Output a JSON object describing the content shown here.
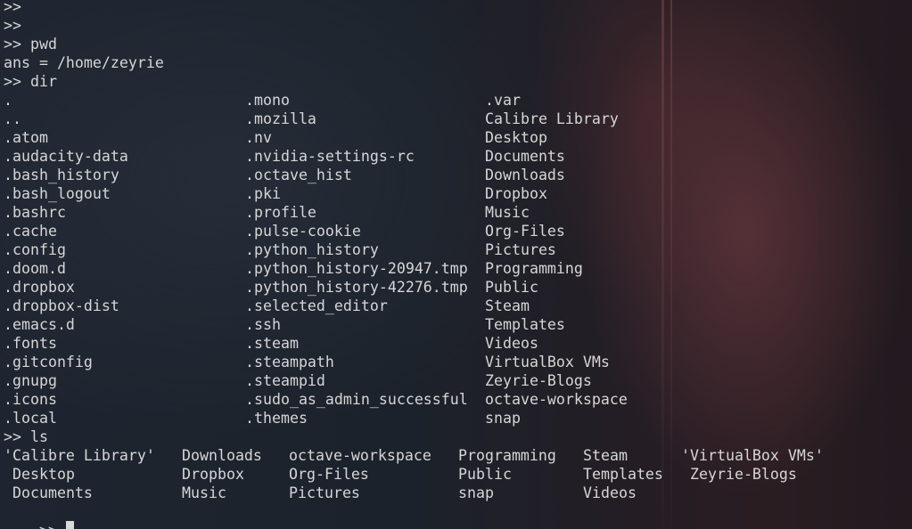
{
  "terminal": {
    "prompt": ">>",
    "blank_prompts": [
      ">>",
      ">>"
    ],
    "pwd_command": ">> pwd",
    "pwd_output": "ans = /home/zeyrie",
    "dir_command": ">> dir",
    "dir_columns": [
      [
        ".",
        "..",
        ".atom",
        ".audacity-data",
        ".bash_history",
        ".bash_logout",
        ".bashrc",
        ".cache",
        ".config",
        ".doom.d",
        ".dropbox",
        ".dropbox-dist",
        ".emacs.d",
        ".fonts",
        ".gitconfig",
        ".gnupg",
        ".icons",
        ".local"
      ],
      [
        ".mono",
        ".mozilla",
        ".nv",
        ".nvidia-settings-rc",
        ".octave_hist",
        ".pki",
        ".profile",
        ".pulse-cookie",
        ".python_history",
        ".python_history-20947.tmp",
        ".python_history-42276.tmp",
        ".selected_editor",
        ".ssh",
        ".steam",
        ".steampath",
        ".steampid",
        ".sudo_as_admin_successful",
        ".themes"
      ],
      [
        ".var",
        "Calibre Library",
        "Desktop",
        "Documents",
        "Downloads",
        "Dropbox",
        "Music",
        "Org-Files",
        "Pictures",
        "Programming",
        "Public",
        "Steam",
        "Templates",
        "Videos",
        "VirtualBox VMs",
        "Zeyrie-Blogs",
        "octave-workspace",
        "snap"
      ]
    ],
    "ls_command": ">> ls",
    "ls_rows": [
      [
        "'Calibre Library'",
        "Downloads",
        "octave-workspace",
        "Programming",
        "Steam",
        "'VirtualBox VMs'"
      ],
      [
        "Desktop",
        "Dropbox",
        "Org-Files",
        "Public",
        "Templates",
        "Zeyrie-Blogs"
      ],
      [
        "Documents",
        "Music",
        "Pictures",
        "snap",
        "Videos",
        ""
      ]
    ],
    "final_prompt": ">>"
  }
}
